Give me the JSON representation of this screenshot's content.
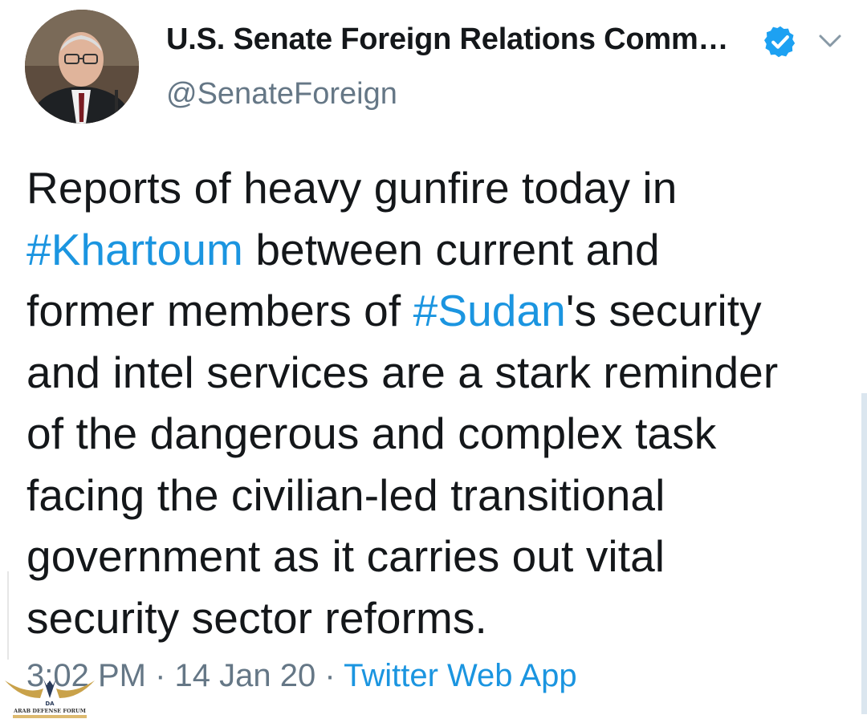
{
  "tweet": {
    "display_name": "U.S. Senate Foreign Relations Comm…",
    "handle": "@SenateForeign",
    "text": {
      "line1": "Reports of heavy gunfire today in",
      "line2_hashtag": "#Khartoum",
      "line2_rest": " between current and",
      "line3_start": "former members of ",
      "line3_hashtag": "#Sudan",
      "line3_rest": "'s security",
      "line4": "and intel services are a stark reminder",
      "line5": "of the dangerous and complex task",
      "line6": "facing the civilian-led transitional",
      "line7": "government as it carries out vital",
      "line8": "security sector reforms."
    },
    "time": "3:02 PM",
    "separator": "·",
    "date": "14 Jan 20",
    "source": "Twitter Web App"
  },
  "watermark": {
    "logo_text": "ARAB DEFENSE FORUM",
    "logo_initials": "DA"
  },
  "colors": {
    "text": "#14171a",
    "secondary": "#657786",
    "link": "#1b95e0",
    "verified": "#1da1f2"
  },
  "icons": {
    "verified": "verified-badge-icon",
    "menu": "chevron-down-icon"
  }
}
